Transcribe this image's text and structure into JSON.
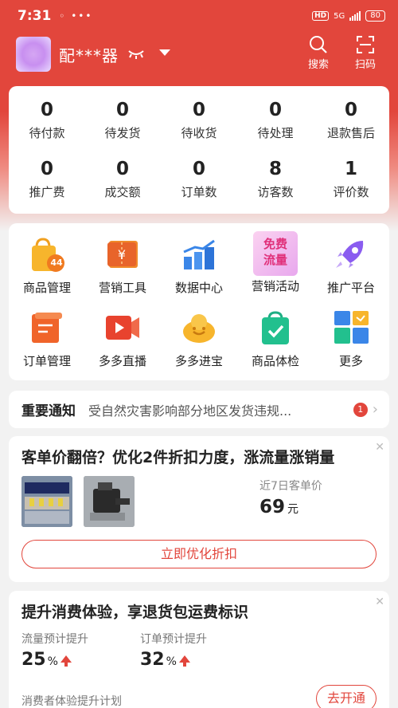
{
  "status_bar": {
    "time": "7:31",
    "left_icons": "◦ •••",
    "hd": "HD",
    "network": "5G",
    "battery": "80"
  },
  "header": {
    "shop_name": "配***器",
    "search_label": "搜索",
    "scan_label": "扫码"
  },
  "stats": [
    {
      "value": "0",
      "label": "待付款"
    },
    {
      "value": "0",
      "label": "待发货"
    },
    {
      "value": "0",
      "label": "待收货"
    },
    {
      "value": "0",
      "label": "待处理"
    },
    {
      "value": "0",
      "label": "退款售后"
    },
    {
      "value": "0",
      "label": "推广费"
    },
    {
      "value": "0",
      "label": "成交额"
    },
    {
      "value": "0",
      "label": "订单数"
    },
    {
      "value": "8",
      "label": "访客数"
    },
    {
      "value": "1",
      "label": "评价数"
    }
  ],
  "tools": [
    {
      "label": "商品管理",
      "icon": "shopping-bag-icon",
      "badge": "44"
    },
    {
      "label": "营销工具",
      "icon": "coupon-icon"
    },
    {
      "label": "数据中心",
      "icon": "bar-chart-icon"
    },
    {
      "label": "营销活动",
      "icon": "free-traffic-icon",
      "badge_line1": "免费",
      "badge_line2": "流量"
    },
    {
      "label": "推广平台",
      "icon": "rocket-icon"
    },
    {
      "label": "订单管理",
      "icon": "order-list-icon"
    },
    {
      "label": "多多直播",
      "icon": "live-video-icon"
    },
    {
      "label": "多多进宝",
      "icon": "treasure-icon"
    },
    {
      "label": "商品体检",
      "icon": "check-bag-icon"
    },
    {
      "label": "更多",
      "icon": "more-apps-icon"
    }
  ],
  "notice": {
    "title": "重要通知",
    "text": "受自然灾害影响部分地区发货违规...",
    "count": "1"
  },
  "promo": {
    "title": "客单价翻倍？优化2件折扣力度，涨流量涨销量",
    "price_label": "近7日客单价",
    "price_value": "69",
    "price_unit": "元",
    "button": "立即优化折扣"
  },
  "consumer": {
    "title": "提升消费体验，享退货包运费标识",
    "traffic_label": "流量预计提升",
    "traffic_value": "25",
    "order_label": "订单预计提升",
    "order_value": "32",
    "pct": "%",
    "plan_label": "消费者体验提升计划",
    "button": "去开通"
  },
  "colors": {
    "brand_red": "#e2463c",
    "background": "#f2f2f2"
  }
}
